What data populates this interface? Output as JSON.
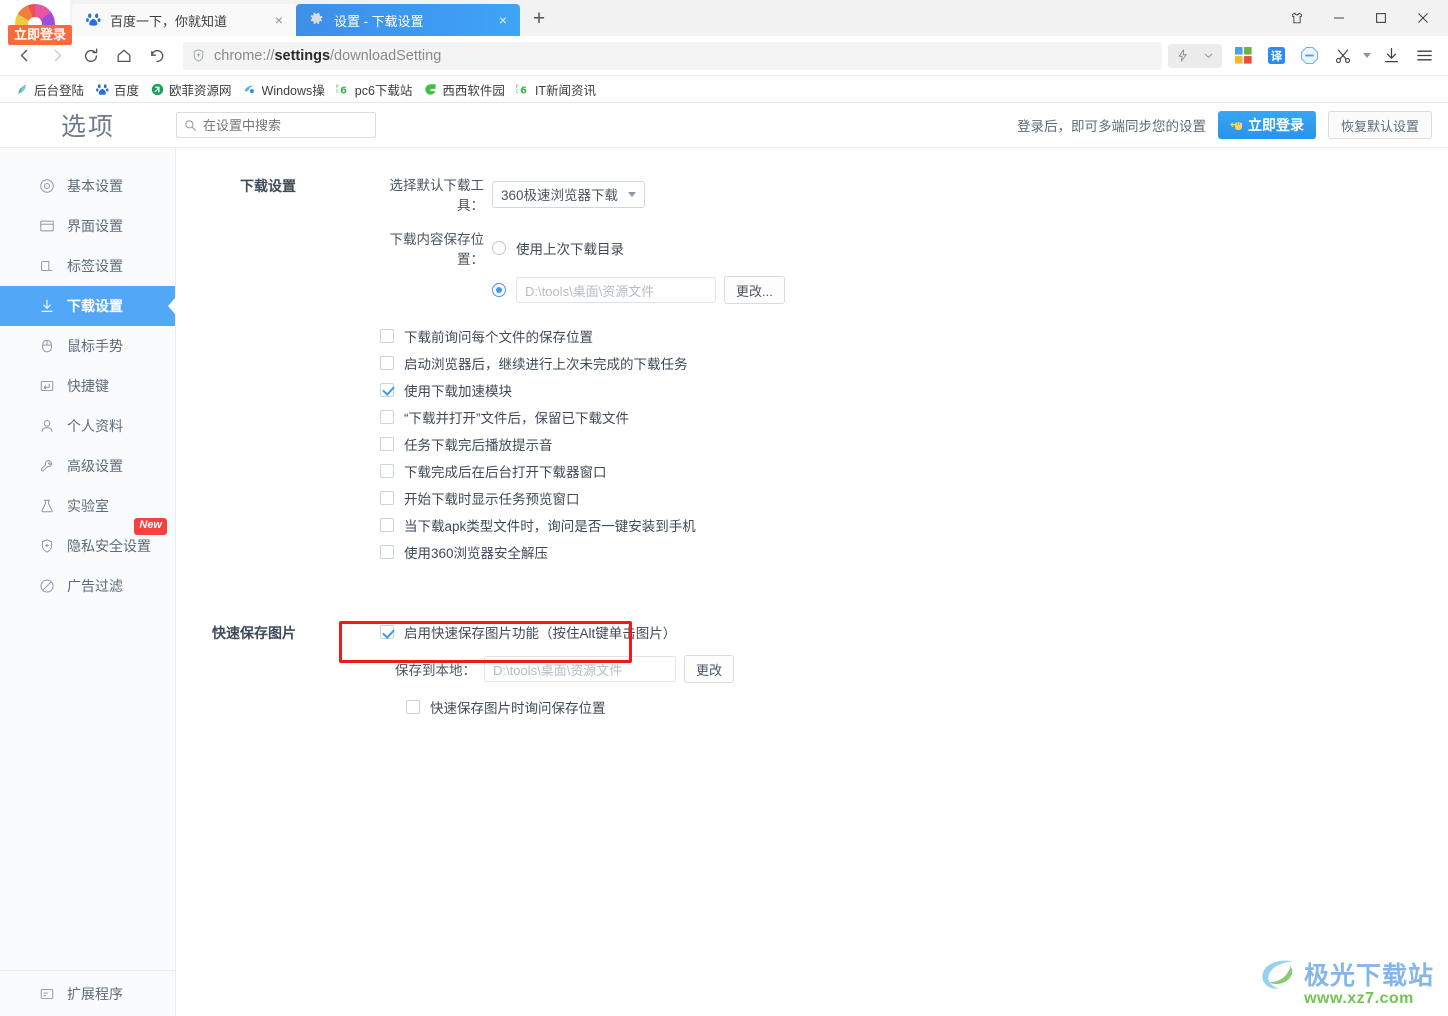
{
  "window": {
    "controls": [
      {
        "name": "skin-button",
        "glyph": "skin"
      },
      {
        "name": "minimize-button",
        "glyph": "minimize"
      },
      {
        "name": "maximize-button",
        "glyph": "maximize"
      },
      {
        "name": "close-button",
        "glyph": "close"
      }
    ],
    "login_badge": "立即登录"
  },
  "tabs": [
    {
      "title": "百度一下，你就知道",
      "active": false,
      "favicon": "baidu-icon",
      "close": "×"
    },
    {
      "title": "设置 - 下载设置",
      "active": true,
      "favicon": "gear-icon",
      "close": "×"
    }
  ],
  "newtab_label": "+",
  "nav": {
    "back": "‹",
    "forward": "›",
    "reload": "⟳",
    "home": "⌂",
    "undo": "↺",
    "url_prefix": "chrome://",
    "url_bold": "settings",
    "url_suffix": "/downloadSetting",
    "lightning": "⚡",
    "chevron": "⌄"
  },
  "toolbar_icons": [
    {
      "name": "windows-apps-icon",
      "label": "windows"
    },
    {
      "name": "translate-icon",
      "label": "译"
    },
    {
      "name": "adblock-icon",
      "label": "block"
    },
    {
      "name": "screenshot-scissors-icon",
      "label": "scissors"
    },
    {
      "name": "scissors-dropdown-icon",
      "label": "▾"
    },
    {
      "name": "downloads-icon",
      "label": "download"
    },
    {
      "name": "menu-icon",
      "label": "menu"
    }
  ],
  "bookmarks": [
    {
      "label": "后台登陆",
      "icon": "swirl-icon"
    },
    {
      "label": "百度",
      "icon": "baidu-icon"
    },
    {
      "label": "欧菲资源网",
      "icon": "green-circle-icon"
    },
    {
      "label": "Windows操",
      "icon": "windows-site-icon"
    },
    {
      "label": "pc6下载站",
      "icon": "pc6-icon"
    },
    {
      "label": "西西软件园",
      "icon": "green-g-icon"
    },
    {
      "label": "IT新闻资讯",
      "icon": "pc6-icon"
    }
  ],
  "header": {
    "title": "选项",
    "search_placeholder": "在设置中搜索",
    "search_value": "",
    "search_icon": "search-icon",
    "sync_text": "登录后，即可多端同步您的设置",
    "login_button": "立即登录",
    "login_button_icon": "hand-pointer-icon",
    "restore_button": "恢复默认设置"
  },
  "sidebar": {
    "items": [
      {
        "label": "基本设置",
        "icon": "target-icon",
        "active": false,
        "badge": null
      },
      {
        "label": "界面设置",
        "icon": "window-icon",
        "active": false,
        "badge": null
      },
      {
        "label": "标签设置",
        "icon": "tab-icon",
        "active": false,
        "badge": null
      },
      {
        "label": "下载设置",
        "icon": "download-icon",
        "active": true,
        "badge": null
      },
      {
        "label": "鼠标手势",
        "icon": "mouse-icon",
        "active": false,
        "badge": null
      },
      {
        "label": "快捷键",
        "icon": "keyboard-icon",
        "active": false,
        "badge": null
      },
      {
        "label": "个人资料",
        "icon": "user-icon",
        "active": false,
        "badge": null
      },
      {
        "label": "高级设置",
        "icon": "wrench-icon",
        "active": false,
        "badge": null
      },
      {
        "label": "实验室",
        "icon": "flask-icon",
        "active": false,
        "badge": null
      },
      {
        "label": "隐私安全设置",
        "icon": "shield-plus-icon",
        "active": false,
        "badge": "New"
      },
      {
        "label": "广告过滤",
        "icon": "block-icon",
        "active": false,
        "badge": null
      }
    ],
    "footer": {
      "label": "扩展程序",
      "icon": "extensions-icon"
    }
  },
  "download_section": {
    "title": "下载设置",
    "tool_label": "选择默认下载工具：",
    "tool_value": "360极速浏览器下载",
    "location_label": "下载内容保存位置：",
    "radio_last_dir": {
      "label": "使用上次下载目录",
      "checked": false
    },
    "radio_custom": {
      "checked": true,
      "path": "D:\\tools\\桌面\\资源文件",
      "button": "更改..."
    },
    "checkboxes": [
      {
        "label": "下载前询问每个文件的保存位置",
        "checked": false
      },
      {
        "label": "启动浏览器后，继续进行上次未完成的下载任务",
        "checked": false
      },
      {
        "label": "使用下载加速模块",
        "checked": true
      },
      {
        "label": "“下载并打开”文件后，保留已下载文件",
        "checked": false
      },
      {
        "label": "任务下载完后播放提示音",
        "checked": false
      },
      {
        "label": "下载完成后在后台打开下载器窗口",
        "checked": false
      },
      {
        "label": "开始下载时显示任务预览窗口",
        "checked": false
      },
      {
        "label": "当下载apk类型文件时，询问是否一键安装到手机",
        "checked": false
      },
      {
        "label": "使用360浏览器安全解压",
        "checked": false
      }
    ]
  },
  "quicksave_section": {
    "title": "快速保存图片",
    "enable_checkbox": {
      "label": "启用快速保存图片功能（按住Alt键单击图片）",
      "checked": true
    },
    "save_label": "保存到本地：",
    "save_path": "D:\\tools\\桌面\\资源文件",
    "save_button": "更改",
    "ask_checkbox": {
      "label": "快速保存图片时询问保存位置",
      "checked": false
    }
  },
  "watermark": {
    "name": "极光下载站",
    "url": "www.xz7.com"
  },
  "colors": {
    "accent_blue": "#52a8f7",
    "tab_active": "#3d99f0",
    "highlight_red": "#ee1b18",
    "badge_red": "#f5413f",
    "login_orange": "#fa6a3c"
  }
}
